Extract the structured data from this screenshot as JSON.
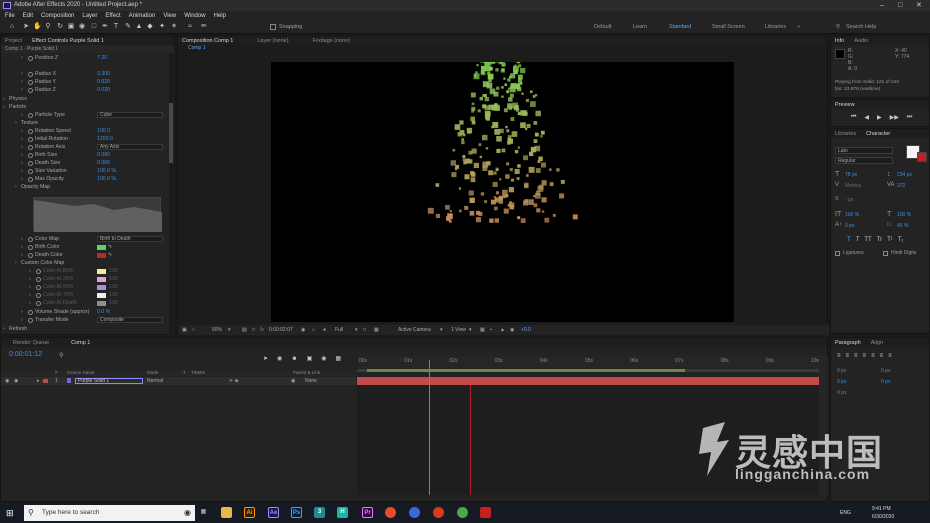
{
  "window": {
    "title": "Adobe After Effects 2020 - Untitled Project.aep *",
    "minimize_icon": "minimize-icon",
    "maximize_icon": "maximize-icon",
    "close_icon": "close-icon"
  },
  "menu": [
    "File",
    "Edit",
    "Composition",
    "Layer",
    "Effect",
    "Animation",
    "View",
    "Window",
    "Help"
  ],
  "toolbar": {
    "snapping_label": "Snapping",
    "workspaces": [
      "Default",
      "Learn",
      "Standard",
      "Small Screen",
      "Libraries"
    ],
    "active_workspace": "Standard",
    "search_placeholder": "Search Help"
  },
  "project_panel": {
    "tabs": [
      "Project",
      "Effect Controls Purple Solid 1"
    ],
    "header": "Comp 1 · Purple Solid 1",
    "rows": [
      {
        "label": "Position Z",
        "value": "7.20"
      },
      {
        "label": "Radius X",
        "value": "0.300"
      },
      {
        "label": "Radius Y",
        "value": "0.020"
      },
      {
        "label": "Radius Z",
        "value": "0.020"
      },
      {
        "label": "Physics",
        "value": ""
      },
      {
        "label": "Particle",
        "value": ""
      },
      {
        "label": "Particle Type",
        "value": "Cube"
      },
      {
        "label": "Texture",
        "value": ""
      },
      {
        "label": "Rotation Speed",
        "value": "100.0"
      },
      {
        "label": "Initial Rotation",
        "value": "1200.0"
      },
      {
        "label": "Rotation Axis",
        "value": "Any Axis"
      },
      {
        "label": "Birth Size",
        "value": "0.080"
      },
      {
        "label": "Death Size",
        "value": "0.060"
      },
      {
        "label": "Size Variation",
        "value": "100.0 %"
      },
      {
        "label": "Max Opacity",
        "value": "100.0 %"
      },
      {
        "label": "Opacity Map",
        "value": ""
      },
      {
        "label": "Color Map",
        "value": "Birth to Death"
      },
      {
        "label": "Birth Color",
        "value": ""
      },
      {
        "label": "Death Color",
        "value": ""
      },
      {
        "label": "Custom Color Map",
        "value": ""
      },
      {
        "label": "Color At Birth",
        "value": "100"
      },
      {
        "label": "Color At 25%",
        "value": "100"
      },
      {
        "label": "Color At 50%",
        "value": "100"
      },
      {
        "label": "Color At 75%",
        "value": "100"
      },
      {
        "label": "Color At Death",
        "value": "100"
      },
      {
        "label": "Volume Shade (approx)",
        "value": "0.0 %"
      },
      {
        "label": "Transfer Mode",
        "value": "Composite"
      },
      {
        "label": "Refresh",
        "value": ""
      }
    ],
    "colors": {
      "birth": "#58d85a",
      "death": "#c02828",
      "cmap": [
        "#f0f090",
        "#e0a0e0",
        "#a890e0",
        "#f0f0f0",
        "#909090"
      ]
    }
  },
  "composition_panel": {
    "tabs": [
      "Composition Comp 1",
      "Layer (none)",
      "Footage (none)"
    ],
    "comp_tab": "Comp 1",
    "zoom": "50%",
    "timecode": "0:00:02:07",
    "resolution": "Full",
    "camera": "Active Camera",
    "view": "1 View",
    "exposure": "+0.0"
  },
  "info_panel": {
    "tabs": [
      "Info",
      "Audio"
    ],
    "x": "X: 40",
    "y": "Y: 774",
    "r": "R:",
    "g": "G:",
    "b": "B:",
    "a": "A: 0",
    "status_1": "Playing from Solid: 121 of 240",
    "status_2": "fps: 23.976 (realtime)"
  },
  "preview_panel": {
    "title": "Preview"
  },
  "character_panel": {
    "tabs": [
      "Libraries",
      "Character"
    ],
    "font": "Lato",
    "style": "Regular",
    "size": "78 px",
    "leading": "234 px",
    "kerning": "Metrics",
    "tracking": "372",
    "stroke": "- px",
    "vscale": "100 %",
    "hscale": "100 %",
    "baseline": "0 px",
    "tsume": "40 %",
    "ligatures": "Ligatures",
    "hindi_digits": "Hindi Digits",
    "styles": [
      "T",
      "T",
      "TT",
      "Tr",
      "T¹",
      "T₁"
    ]
  },
  "paragraph_panel": {
    "tabs": [
      "Paragraph",
      "Align"
    ],
    "values": [
      "0 px",
      "0 px",
      "0 px",
      "0 px",
      "0 px"
    ]
  },
  "timeline": {
    "tabs": [
      "Render Queue",
      "Comp 1"
    ],
    "timecode": "0:00:01:12",
    "columns": [
      "#",
      "Source Name",
      "Mode",
      "T",
      "TrkMat",
      "Parent & Link"
    ],
    "layer": {
      "index": "1",
      "name": "Purple Solid 1",
      "mode": "Normal",
      "parent": "None"
    },
    "ruler": [
      "00s",
      "01s",
      "02s",
      "03s",
      "04s",
      "05s",
      "06s",
      "07s",
      "08s",
      "09s",
      "10s"
    ],
    "playhead_fraction": 0.155
  },
  "taskbar": {
    "search_placeholder": "Type here to search",
    "time": "9:41 PM",
    "date": "6/30/2020",
    "lang": "ENG"
  },
  "watermark": {
    "cn": "灵感中国",
    "url": "lingganchina.com"
  },
  "particles": {
    "color_top": "#7ad854",
    "color_bottom": "#c88a5c"
  }
}
